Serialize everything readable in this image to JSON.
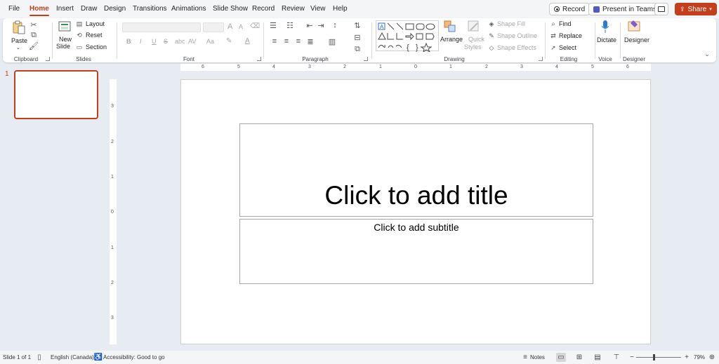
{
  "menu": {
    "tabs": [
      "File",
      "Home",
      "Insert",
      "Draw",
      "Design",
      "Transitions",
      "Animations",
      "Slide Show",
      "Record",
      "Review",
      "View",
      "Help"
    ],
    "record_button": "Record",
    "present_teams_button": "Present in Teams",
    "share_button": "Share"
  },
  "ribbon": {
    "clipboard": {
      "label": "Clipboard",
      "paste": "Paste"
    },
    "slides": {
      "label": "Slides",
      "new_slide_1": "New",
      "new_slide_2": "Slide",
      "layout": "Layout",
      "reset": "Reset",
      "section": "Section"
    },
    "font": {
      "label": "Font",
      "bold": "B",
      "italic": "I",
      "underline": "U",
      "strike": "S",
      "grow": "A",
      "shrink": "A",
      "case": "Aa",
      "color": "A"
    },
    "paragraph": {
      "label": "Paragraph"
    },
    "drawing": {
      "label": "Drawing",
      "arrange": "Arrange",
      "quick_styles_1": "Quick",
      "quick_styles_2": "Styles",
      "shape_fill": "Shape Fill",
      "shape_outline": "Shape Outline",
      "shape_effects": "Shape Effects"
    },
    "editing": {
      "label": "Editing",
      "find": "Find",
      "replace": "Replace",
      "select": "Select"
    },
    "voice": {
      "label": "Voice",
      "dictate": "Dictate"
    },
    "designer": {
      "label": "Designer",
      "designer": "Designer"
    }
  },
  "ruler": {
    "horizontal": [
      "6",
      "5",
      "4",
      "3",
      "2",
      "1",
      "0",
      "1",
      "2",
      "3",
      "4",
      "5",
      "6"
    ],
    "vertical": [
      "3",
      "2",
      "1",
      "0",
      "1",
      "2",
      "3"
    ]
  },
  "slides_pane": {
    "slide_number": "1"
  },
  "slide": {
    "title_placeholder": "Click to add title",
    "subtitle_placeholder": "Click to add subtitle"
  },
  "status": {
    "slide_info": "Slide 1 of 1",
    "language": "English (Canada)",
    "accessibility": "Accessibility: Good to go",
    "notes": "Notes",
    "zoom": "79%"
  },
  "colors": {
    "accent": "#c43e1c"
  }
}
